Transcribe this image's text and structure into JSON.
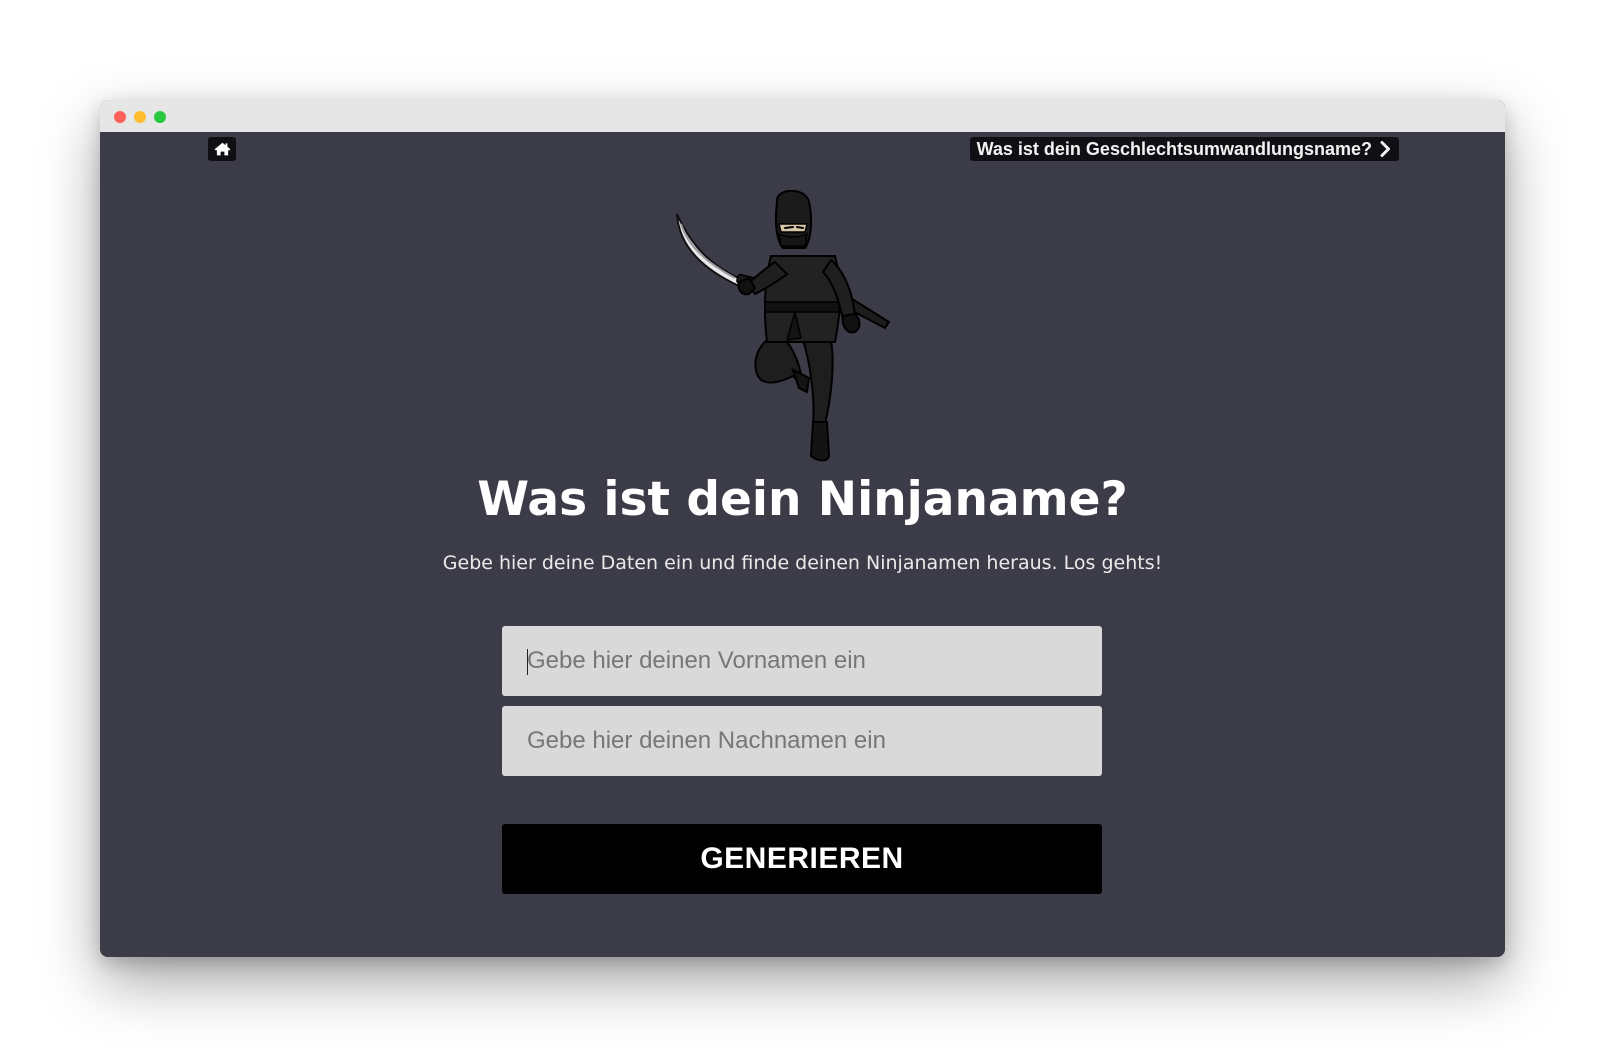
{
  "nav": {
    "home_icon": "home-icon",
    "next_label": "Was ist dein Geschlechtsumwandlungsname?",
    "next_icon": "chevron-right-icon"
  },
  "hero": {
    "image": "ninja-illustration",
    "title": "Was ist dein Ninjaname?",
    "subtitle": "Gebe hier deine Daten ein und finde deinen Ninjanamen heraus. Los gehts!"
  },
  "form": {
    "first_name_placeholder": "Gebe hier deinen Vornamen ein",
    "first_name_value": "",
    "last_name_placeholder": "Gebe hier deinen Nachnamen ein",
    "last_name_value": "",
    "submit_label": "GENERIEREN"
  },
  "colors": {
    "background": "#3c3c49",
    "input_bg": "#d9d9d9",
    "button_bg": "#000000",
    "titlebar": "#e6e6e6"
  }
}
